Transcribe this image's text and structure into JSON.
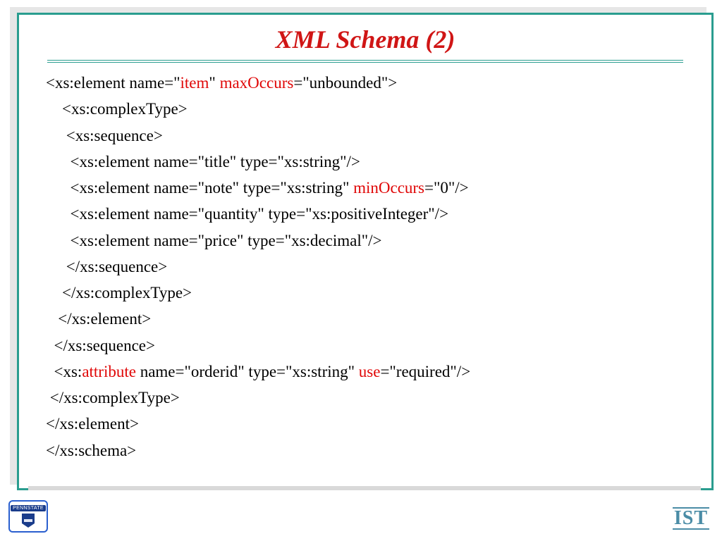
{
  "title": "XML Schema (2)",
  "code": {
    "l1a": "<xs:element name=\"",
    "l1b": "item",
    "l1c": "\" ",
    "l1d": "maxOccurs",
    "l1e": "=\"unbounded\">",
    "l2": "    <xs:complexType>",
    "l3": "     <xs:sequence>",
    "l4": "      <xs:element name=\"title\" type=\"xs:string\"/>",
    "l5a": "      <xs:element name=\"note\" type=\"xs:string\" ",
    "l5b": "minOccurs",
    "l5c": "=\"0\"/>",
    "l6": "      <xs:element name=\"quantity\" type=\"xs:positiveInteger\"/>",
    "l7": "      <xs:element name=\"price\" type=\"xs:decimal\"/>",
    "l8": "     </xs:sequence>",
    "l9": "    </xs:complexType>",
    "l10": "   </xs:element>",
    "l11": "  </xs:sequence>",
    "l12a": "  <xs:",
    "l12b": "attribute",
    "l12c": " name=\"orderid\" type=\"xs:string\" ",
    "l12d": "use",
    "l12e": "=\"required\"/>",
    "l13": " </xs:complexType>",
    "l14": "</xs:element>",
    "l15": "</xs:schema>"
  },
  "logos": {
    "left": "PENNSTATE",
    "right": "IST"
  }
}
